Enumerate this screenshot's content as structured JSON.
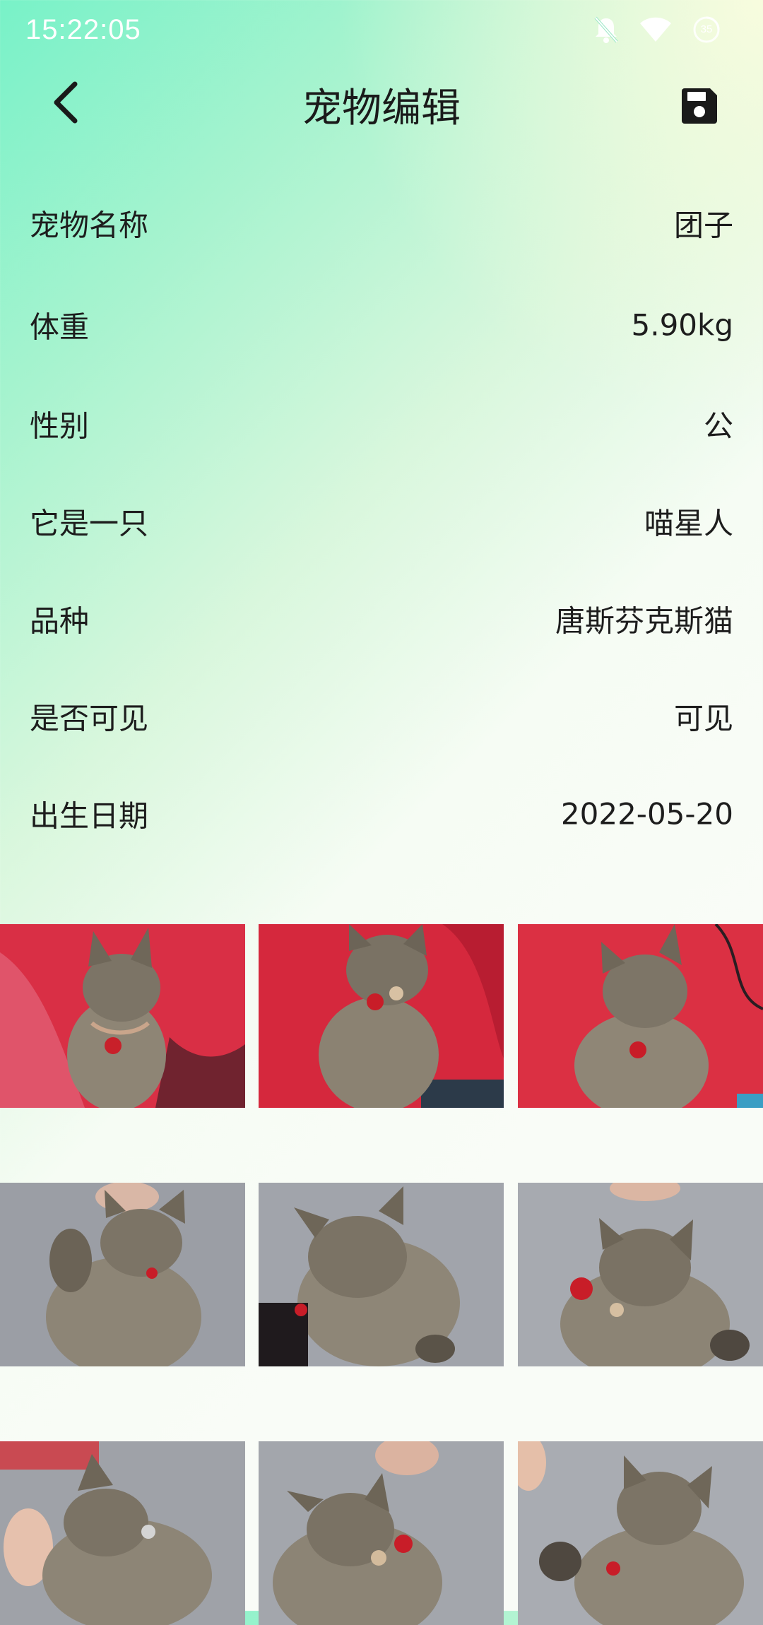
{
  "status_bar": {
    "time": "15:22:05",
    "icons": [
      "bell-off-icon",
      "wifi-icon",
      "battery-icon"
    ],
    "battery_level": "35"
  },
  "app_bar": {
    "title": "宠物编辑",
    "back_icon": "chevron-left-icon",
    "save_icon": "floppy-disk-icon"
  },
  "fields": [
    {
      "label": "宠物名称",
      "value": "团子"
    },
    {
      "label": "体重",
      "value": "5.90kg"
    },
    {
      "label": "性别",
      "value": "公"
    },
    {
      "label": "它是一只",
      "value": "喵星人"
    },
    {
      "label": "品种",
      "value": "唐斯芬克斯猫"
    },
    {
      "label": "是否可见",
      "value": "可见"
    },
    {
      "label": "出生日期",
      "value": "2022-05-20"
    }
  ],
  "photos": [
    {
      "scene": "kitten on red sofa",
      "background": "#d92f45"
    },
    {
      "scene": "kitten on red sofa",
      "background": "#d5283d"
    },
    {
      "scene": "kitten on red sofa",
      "background": "#db3043"
    },
    {
      "scene": "kitten on grey floor",
      "background": "#9b9ea5"
    },
    {
      "scene": "kitten on grey floor",
      "background": "#a1a4ab"
    },
    {
      "scene": "kitten on grey floor",
      "background": "#a7aab0"
    },
    {
      "scene": "kitten on grey floor",
      "background": "#9fa2a8"
    },
    {
      "scene": "kitten on grey floor",
      "background": "#a3a6ac"
    },
    {
      "scene": "kitten on grey floor",
      "background": "#a9acb2"
    }
  ],
  "colors": {
    "gradient_start": "#78f2c8",
    "page_background": "#f9fcf7",
    "text": "#1d1d1d"
  }
}
